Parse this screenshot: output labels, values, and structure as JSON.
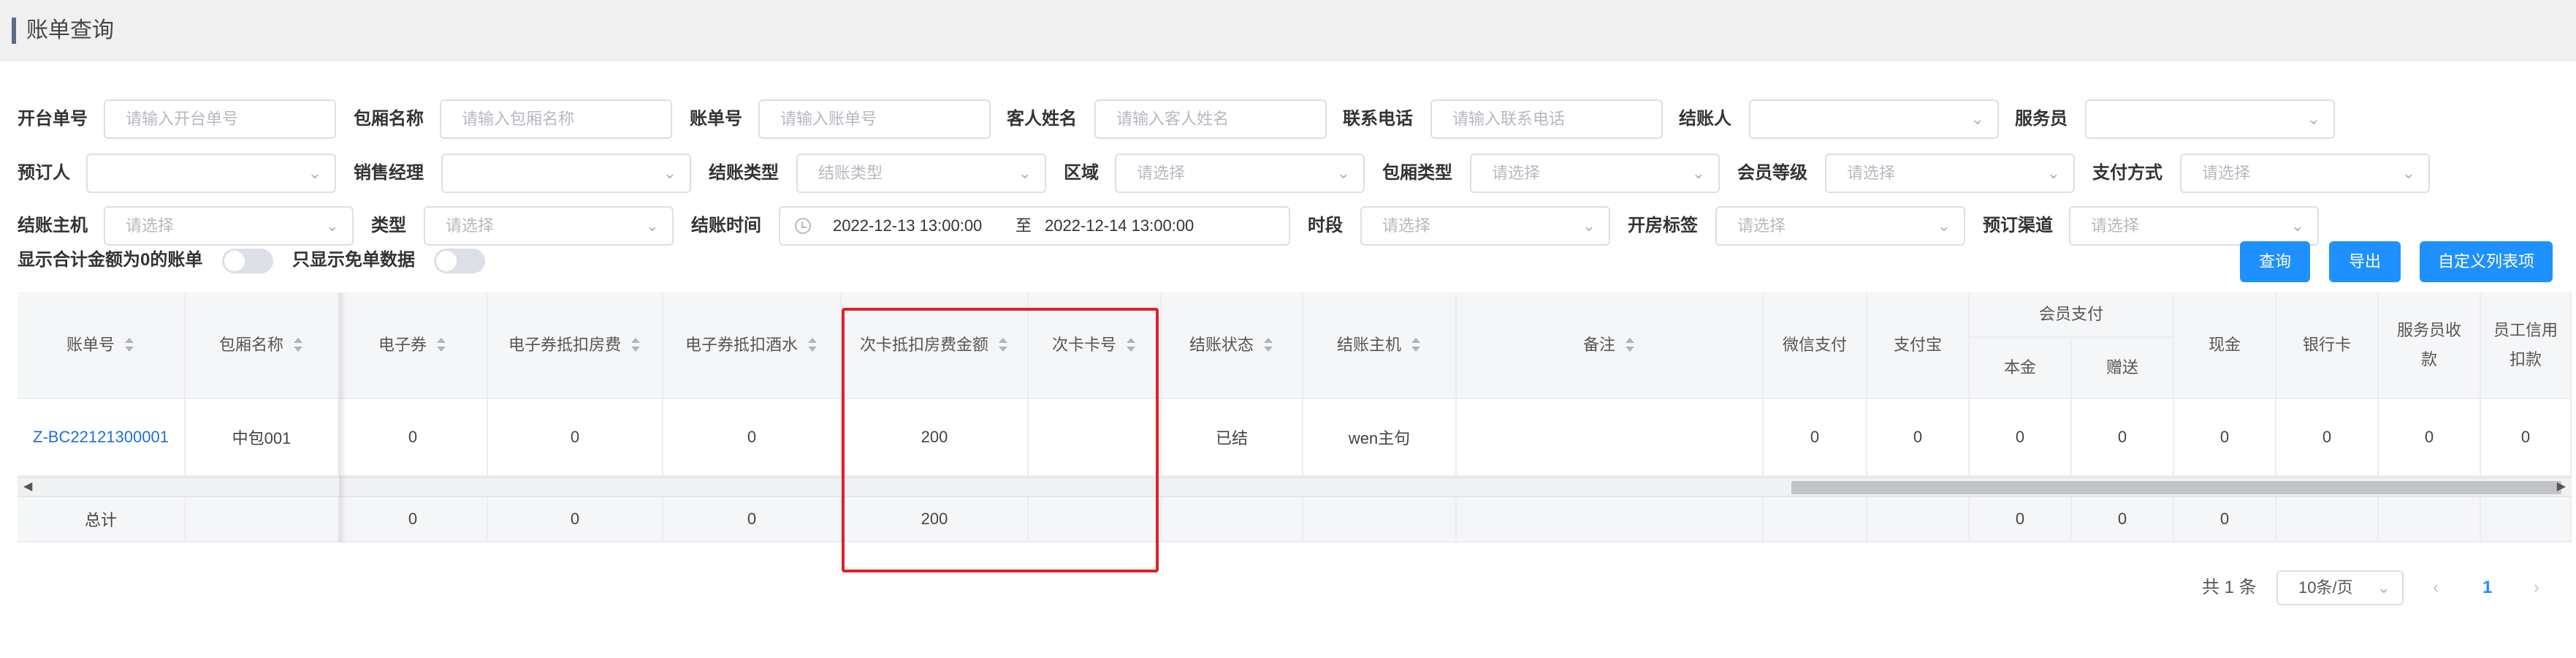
{
  "header": {
    "title": "账单查询"
  },
  "filters": {
    "open_order_no": {
      "label": "开台单号",
      "placeholder": "请输入开台单号"
    },
    "room_name": {
      "label": "包厢名称",
      "placeholder": "请输入包厢名称"
    },
    "bill_no": {
      "label": "账单号",
      "placeholder": "请输入账单号"
    },
    "guest_name": {
      "label": "客人姓名",
      "placeholder": "请输入客人姓名"
    },
    "phone": {
      "label": "联系电话",
      "placeholder": "请输入联系电话"
    },
    "checkout_person": {
      "label": "结账人",
      "value": ""
    },
    "waiter": {
      "label": "服务员",
      "value": ""
    },
    "booker": {
      "label": "预订人",
      "value": ""
    },
    "sales_manager": {
      "label": "销售经理",
      "value": ""
    },
    "checkout_type": {
      "label": "结账类型",
      "placeholder": "结账类型"
    },
    "area": {
      "label": "区域",
      "placeholder": "请选择"
    },
    "room_type": {
      "label": "包厢类型",
      "placeholder": "请选择"
    },
    "member_level": {
      "label": "会员等级",
      "placeholder": "请选择"
    },
    "payment_method": {
      "label": "支付方式",
      "placeholder": "请选择"
    },
    "checkout_host": {
      "label": "结账主机",
      "placeholder": "请选择"
    },
    "type": {
      "label": "类型",
      "placeholder": "请选择"
    },
    "checkout_time": {
      "label": "结账时间",
      "start": "2022-12-13 13:00:00",
      "separator": "至",
      "end": "2022-12-14 13:00:00"
    },
    "time_slot": {
      "label": "时段",
      "placeholder": "请选择"
    },
    "open_tag": {
      "label": "开房标签",
      "placeholder": "请选择"
    },
    "booking_channel": {
      "label": "预订渠道",
      "placeholder": "请选择"
    }
  },
  "toggles": {
    "show_zero_total": {
      "label": "显示合计金额为0的账单",
      "on": false
    },
    "only_free": {
      "label": "只显示免单数据",
      "on": false
    }
  },
  "buttons": {
    "query": "查询",
    "export": "导出",
    "custom_columns": "自定义列表项"
  },
  "table": {
    "headers": {
      "bill_no": "账单号",
      "room_name": "包厢名称",
      "ecoupon": "电子券",
      "ecoupon_room": "电子券抵扣房费",
      "ecoupon_drink": "电子券抵扣酒水",
      "times_card_room": "次卡抵扣房费金额",
      "times_card_no": "次卡卡号",
      "status": "结账状态",
      "host": "结账主机",
      "remark": "备注",
      "wechat": "微信支付",
      "alipay": "支付宝",
      "member_pay": "会员支付",
      "principal": "本金",
      "gift": "赠送",
      "cash": "现金",
      "bank_card": "银行卡",
      "waiter_collect": "服务员收款",
      "staff_credit": "员工信用扣款"
    },
    "rows": [
      {
        "bill_no": "Z-BC22121300001",
        "room_name": "中包001",
        "ecoupon": "0",
        "ecoupon_room": "0",
        "ecoupon_drink": "0",
        "times_card_room": "200",
        "times_card_no": "",
        "status": "已结",
        "host": "wen主句",
        "remark": "",
        "wechat": "0",
        "alipay": "0",
        "principal": "0",
        "gift": "0",
        "cash": "0",
        "bank_card": "0",
        "waiter_collect": "0",
        "staff_credit": "0"
      }
    ],
    "footer": {
      "label": "总计",
      "ecoupon": "0",
      "ecoupon_room": "0",
      "ecoupon_drink": "0",
      "times_card_room": "200",
      "principal": "0",
      "gift": "0",
      "cash": "0"
    }
  },
  "pagination": {
    "total": "共 1 条",
    "page_size": "10条/页",
    "current_page": "1"
  },
  "colors": {
    "primary": "#1e90ff",
    "highlight": "#e0202a",
    "link": "#1e6fd9"
  }
}
